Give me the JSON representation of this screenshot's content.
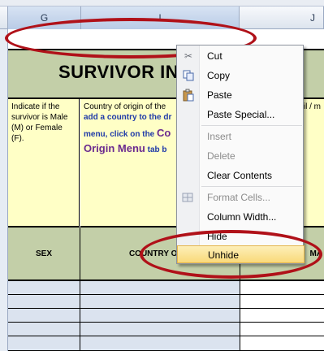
{
  "column_headers": {
    "g": "G",
    "i": "I",
    "j": "J"
  },
  "title": "SURVIVOR IN",
  "description_g": "Indicate if the survivor is Male (M) or Female (F).",
  "description_i": {
    "line1": "Country of origin of the",
    "line2": "add a country to the dr",
    "line3a": "menu, click on the ",
    "line3b": "Co",
    "line4a": "Origin Menu",
    "line4b": " tab b"
  },
  "description_j": "vil / m",
  "headers": {
    "sex": "SEX",
    "country": "COUNTRY OF O",
    "marital": "MA"
  },
  "context_menu": {
    "items": [
      {
        "label": "Cut",
        "icon": "scissors-icon",
        "disabled": false
      },
      {
        "label": "Copy",
        "icon": "copy-icon",
        "disabled": false
      },
      {
        "label": "Paste",
        "icon": "paste-icon",
        "disabled": false
      },
      {
        "label": "Paste Special...",
        "icon": "",
        "disabled": false
      },
      {
        "label": "Insert",
        "icon": "",
        "disabled": true
      },
      {
        "label": "Delete",
        "icon": "",
        "disabled": true
      },
      {
        "label": "Clear Contents",
        "icon": "",
        "disabled": false
      },
      {
        "label": "Format Cells...",
        "icon": "format-cells-icon",
        "disabled": true
      },
      {
        "label": "Column Width...",
        "icon": "",
        "disabled": false
      },
      {
        "label": "Hide",
        "icon": "",
        "disabled": false
      },
      {
        "label": "Unhide",
        "icon": "",
        "disabled": false,
        "highlighted": true
      }
    ]
  },
  "colors": {
    "annotation": "#b01119",
    "band": "#c3cfa8",
    "note_bg": "#ffffc6",
    "menu_highlight": "#f9d97a"
  }
}
